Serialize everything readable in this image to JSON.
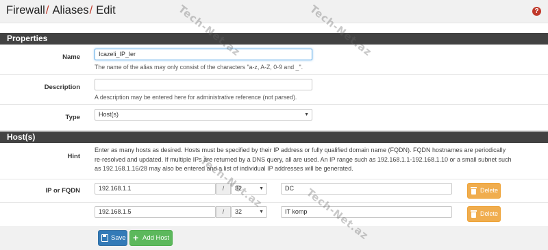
{
  "breadcrumb": [
    "Firewall",
    "Aliases",
    "Edit"
  ],
  "properties": {
    "heading": "Properties",
    "name": {
      "label": "Name",
      "value": "Icazeli_IP_ler",
      "help": "The name of the alias may only consist of the characters \"a-z, A-Z, 0-9 and _\"."
    },
    "description": {
      "label": "Description",
      "value": "",
      "help": "A description may be entered here for administrative reference (not parsed)."
    },
    "type": {
      "label": "Type",
      "value": "Host(s)"
    }
  },
  "hosts": {
    "heading": "Host(s)",
    "hint_label": "Hint",
    "hint_lines": [
      "Enter as many hosts as desired. Hosts must be specified by their IP address or fully qualified domain name (FQDN). FQDN hostnames are periodically",
      "re-resolved and updated. If multiple IPs are returned by a DNS query, all are used. An IP range such as 192.168.1.1-192.168.1.10 or a small subnet such",
      "as 192.168.1.16/28 may also be entered and a list of individual IP addresses will be generated."
    ],
    "ip_label": "IP or FQDN",
    "slash": "/",
    "delete_label": "Delete",
    "entries": [
      {
        "address": "192.168.1.1",
        "cidr": "32",
        "description": "DC"
      },
      {
        "address": "192.168.1.5",
        "cidr": "32",
        "description": "IT komp"
      }
    ]
  },
  "footer": {
    "save_label": "Save",
    "add_host_label": "Add Host"
  },
  "watermark": "Tech-Net.az",
  "colors": {
    "header_bar": "#424242",
    "accent_red": "#c0392b",
    "save_blue": "#337ab7",
    "add_green": "#5cb85c",
    "delete_orange": "#f0ad4e"
  }
}
